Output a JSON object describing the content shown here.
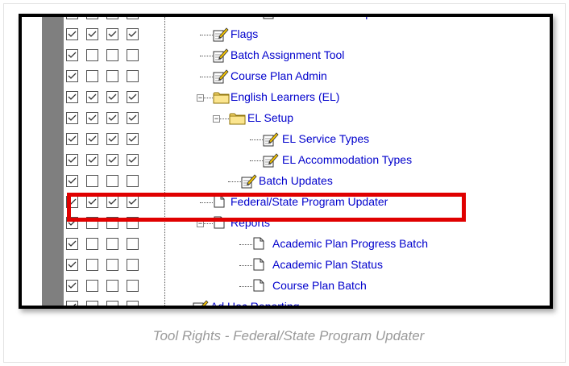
{
  "caption": "Tool Rights - Federal/State Program Updater",
  "tree": {
    "rows": [
      {
        "label": "Print Session Report",
        "checks": [
          true,
          false,
          false,
          false
        ],
        "icon": "page-icon"
      },
      {
        "label": "Flags",
        "checks": [
          true,
          true,
          true,
          true
        ],
        "icon": "edit-icon"
      },
      {
        "label": "Batch Assignment Tool",
        "checks": [
          true,
          false,
          false,
          false
        ],
        "icon": "edit-icon"
      },
      {
        "label": "Course Plan Admin",
        "checks": [
          true,
          false,
          false,
          false
        ],
        "icon": "edit-icon"
      },
      {
        "label": "English Learners (EL)",
        "checks": [
          true,
          true,
          true,
          true
        ],
        "icon": "folder-icon"
      },
      {
        "label": "EL Setup",
        "checks": [
          true,
          true,
          true,
          true
        ],
        "icon": "folder-icon"
      },
      {
        "label": "EL Service Types",
        "checks": [
          true,
          true,
          true,
          true
        ],
        "icon": "edit-icon"
      },
      {
        "label": "EL Accommodation Types",
        "checks": [
          true,
          true,
          true,
          true
        ],
        "icon": "edit-icon"
      },
      {
        "label": "Batch Updates",
        "checks": [
          true,
          false,
          false,
          false
        ],
        "icon": "edit-icon"
      },
      {
        "label": "Federal/State Program Updater",
        "checks": [
          true,
          true,
          true,
          true
        ],
        "icon": "page-icon"
      },
      {
        "label": "Reports",
        "checks": [
          true,
          false,
          false,
          false
        ],
        "icon": "page-icon"
      },
      {
        "label": "Academic Plan Progress Batch",
        "checks": [
          true,
          false,
          false,
          false
        ],
        "icon": "page-icon"
      },
      {
        "label": "Academic Plan Status",
        "checks": [
          true,
          false,
          false,
          false
        ],
        "icon": "page-icon"
      },
      {
        "label": "Course Plan Batch",
        "checks": [
          true,
          false,
          false,
          false
        ],
        "icon": "page-icon"
      },
      {
        "label": "Ad Hoc Reporting",
        "checks": [
          true,
          false,
          false,
          false
        ],
        "icon": "edit-icon"
      }
    ]
  },
  "colors": {
    "link": "#0000cc",
    "highlight": "#e00000",
    "folder": "#f5d76e"
  }
}
